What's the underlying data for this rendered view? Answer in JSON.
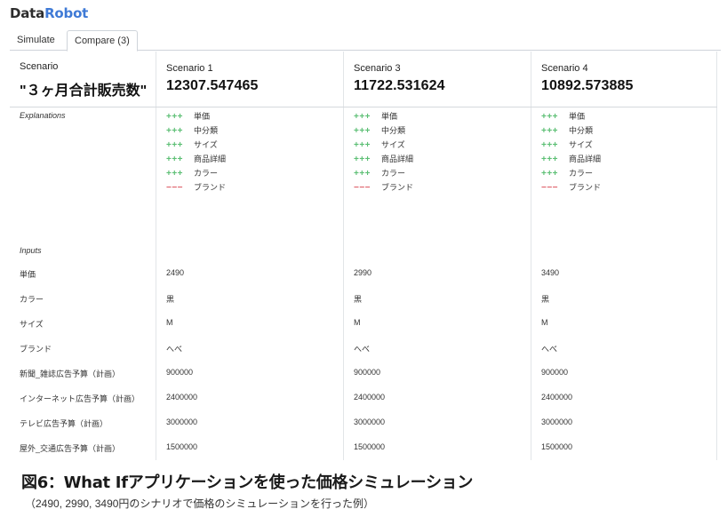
{
  "logo": {
    "part1": "Data",
    "part2": "Robot"
  },
  "tabs": [
    {
      "label": "Simulate"
    },
    {
      "label": "Compare (3)"
    }
  ],
  "scenario_header": {
    "label": "Scenario",
    "target": "\"３ヶ月合計販売数\""
  },
  "scenarios": [
    {
      "name": "Scenario 1",
      "value": "12307.547465",
      "inputs": [
        "2490",
        "黒",
        "M",
        "へべ",
        "900000",
        "2400000",
        "3000000",
        "1500000"
      ]
    },
    {
      "name": "Scenario 3",
      "value": "11722.531624",
      "inputs": [
        "2990",
        "黒",
        "M",
        "へべ",
        "900000",
        "2400000",
        "3000000",
        "1500000"
      ]
    },
    {
      "name": "Scenario 4",
      "value": "10892.573885",
      "inputs": [
        "3490",
        "黒",
        "M",
        "へべ",
        "900000",
        "2400000",
        "3000000",
        "1500000"
      ]
    }
  ],
  "sections": {
    "explanations": "Explanations",
    "inputs": "Inputs"
  },
  "explanations": [
    {
      "sign": "+++",
      "name": "単価",
      "direction": "positive"
    },
    {
      "sign": "+++",
      "name": "中分類",
      "direction": "positive"
    },
    {
      "sign": "+++",
      "name": "サイズ",
      "direction": "positive"
    },
    {
      "sign": "+++",
      "name": "商品詳細",
      "direction": "positive"
    },
    {
      "sign": "+++",
      "name": "カラー",
      "direction": "positive"
    },
    {
      "sign": "−−−",
      "name": "ブランド",
      "direction": "negative"
    }
  ],
  "input_labels": [
    "単価",
    "カラー",
    "サイズ",
    "ブランド",
    "新聞_雑誌広告予算（計画）",
    "インターネット広告予算（計画）",
    "テレビ広告予算（計画）",
    "屋外_交通広告予算（計画）"
  ],
  "caption": "図6：What Ifアプリケーションを使った価格シミュレーション",
  "subcaption": "（2490, 2990, 3490円のシナリオで価格のシミュレーションを行った例）",
  "colors": {
    "positive": "#5cbf74",
    "negative": "#e0616a",
    "brand_accent": "#3f7ad6"
  }
}
